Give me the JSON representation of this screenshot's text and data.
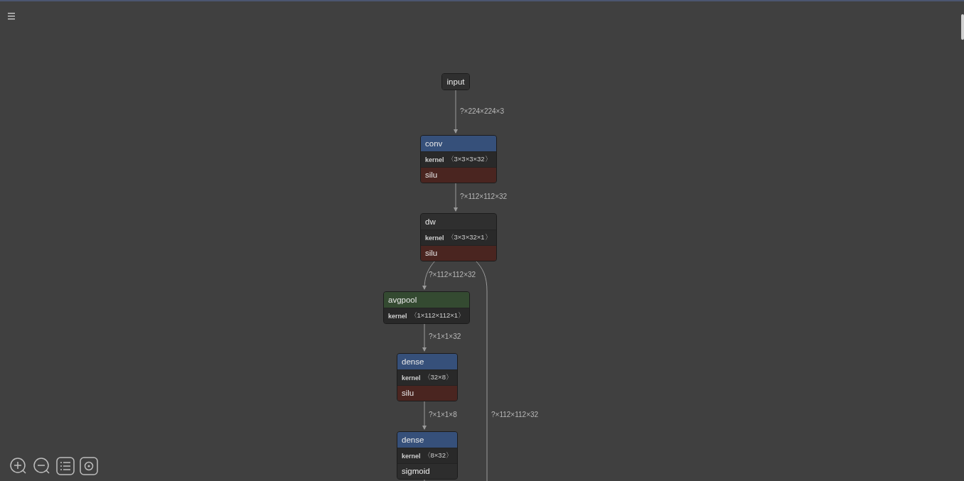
{
  "nodes": [
    {
      "title": "input",
      "kind": "input"
    },
    {
      "title": "conv",
      "kind": "layer",
      "attributes": [
        {
          "name": "kernel",
          "value": "〈3×3×3×32〉"
        }
      ],
      "activation": {
        "label": "silu",
        "kind": "activation"
      }
    },
    {
      "title": "dw",
      "kind": "plain",
      "attributes": [
        {
          "name": "kernel",
          "value": "〈3×3×32×1〉"
        }
      ],
      "activation": {
        "label": "silu",
        "kind": "activation"
      }
    },
    {
      "title": "avgpool",
      "kind": "pool",
      "attributes": [
        {
          "name": "kernel",
          "value": "〈1×112×112×1〉"
        }
      ]
    },
    {
      "title": "dense",
      "kind": "layer",
      "attributes": [
        {
          "name": "kernel",
          "value": "〈32×8〉"
        }
      ],
      "activation": {
        "label": "silu",
        "kind": "activation"
      }
    },
    {
      "title": "dense",
      "kind": "layer",
      "attributes": [
        {
          "name": "kernel",
          "value": "〈8×32〉"
        }
      ],
      "activation": {
        "label": "sigmoid",
        "kind": "plain"
      }
    }
  ],
  "edges": [
    {
      "label": "?×224×224×3"
    },
    {
      "label": "?×112×112×32"
    },
    {
      "label": "?×112×112×32"
    },
    {
      "label": "?×1×1×32"
    },
    {
      "label": "?×1×1×8"
    },
    {
      "label": "?×112×112×32"
    }
  ]
}
